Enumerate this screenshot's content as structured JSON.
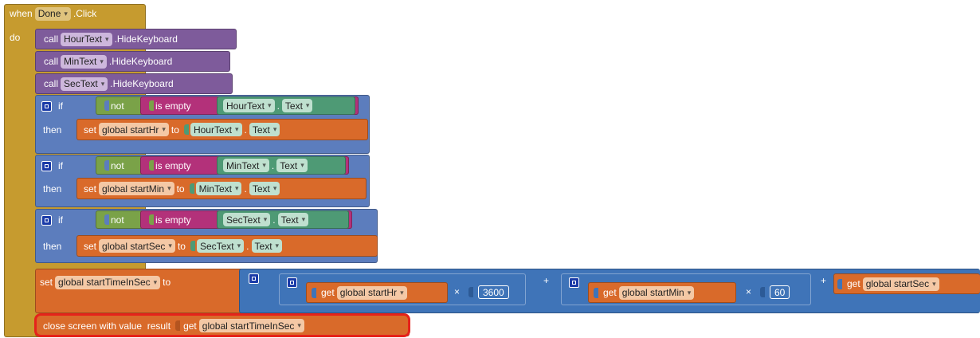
{
  "colors": {
    "event": "#c69b2f",
    "call": "#7e5b9b",
    "control": "#5c7dbd",
    "logic": "#7aa248",
    "text": "#b3317a",
    "setter": "#d96a2a",
    "component": "#4e9a75",
    "math": "#3f74b8",
    "highlight": "#e5231b"
  },
  "event": {
    "when": "when",
    "component": "Done",
    "event": ".Click",
    "do": "do"
  },
  "calls": [
    {
      "keyword": "call",
      "component": "HourText",
      "method": ".HideKeyboard"
    },
    {
      "keyword": "call",
      "component": "MinText",
      "method": ".HideKeyboard"
    },
    {
      "keyword": "call",
      "component": "SecText",
      "method": ".HideKeyboard"
    }
  ],
  "ifs": [
    {
      "if": "if",
      "not": "not",
      "isempty": "is empty",
      "component": "HourText",
      "dot": ".",
      "prop": "Text",
      "then": "then",
      "set": "set",
      "variable": "global startHr",
      "to": "to",
      "val_component": "HourText",
      "val_dot": ".",
      "val_prop": "Text"
    },
    {
      "if": "if",
      "not": "not",
      "isempty": "is empty",
      "component": "MinText",
      "dot": ".",
      "prop": "Text",
      "then": "then",
      "set": "set",
      "variable": "global startMin",
      "to": "to",
      "val_component": "MinText",
      "val_dot": ".",
      "val_prop": "Text"
    },
    {
      "if": "if",
      "not": "not",
      "isempty": "is empty",
      "component": "SecText",
      "dot": ".",
      "prop": "Text",
      "then": "then",
      "set": "set",
      "variable": "global startSec",
      "to": "to",
      "val_component": "SecText",
      "val_dot": ".",
      "val_prop": "Text"
    }
  ],
  "total": {
    "set": "set",
    "variable": "global startTimeInSec",
    "to": "to",
    "plus": "+",
    "times": "×",
    "get": "get",
    "hr_var": "global startHr",
    "hr_factor": "3600",
    "min_var": "global startMin",
    "min_factor": "60",
    "sec_var": "global startSec"
  },
  "close": {
    "label": "close screen with value  result",
    "get": "get",
    "variable": "global startTimeInSec"
  }
}
